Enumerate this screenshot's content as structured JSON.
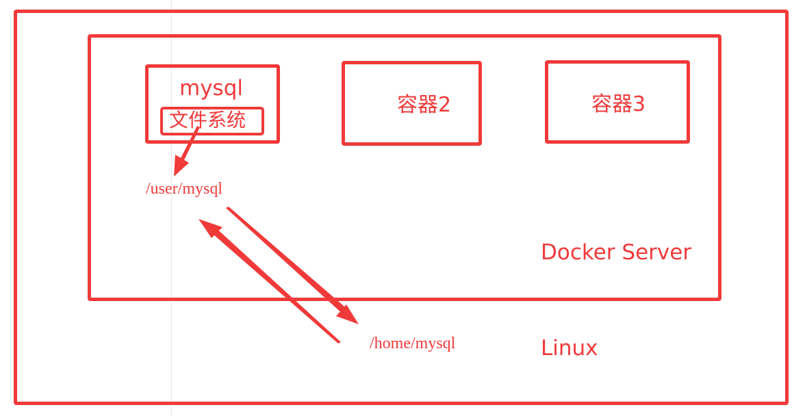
{
  "diagram": {
    "outer_label": "Linux",
    "server_label": "Docker Server",
    "containers": [
      {
        "name": "mysql",
        "sub_label": "文件系统"
      },
      {
        "name": "容器2"
      },
      {
        "name": "容器3"
      }
    ],
    "container_path": "/user/mysql",
    "host_path": "/home/mysql",
    "colors": {
      "stroke": "#f03a3a",
      "text": "#f03a3a",
      "guide_line": "#e6e6e6",
      "background": "#ffffff"
    }
  }
}
